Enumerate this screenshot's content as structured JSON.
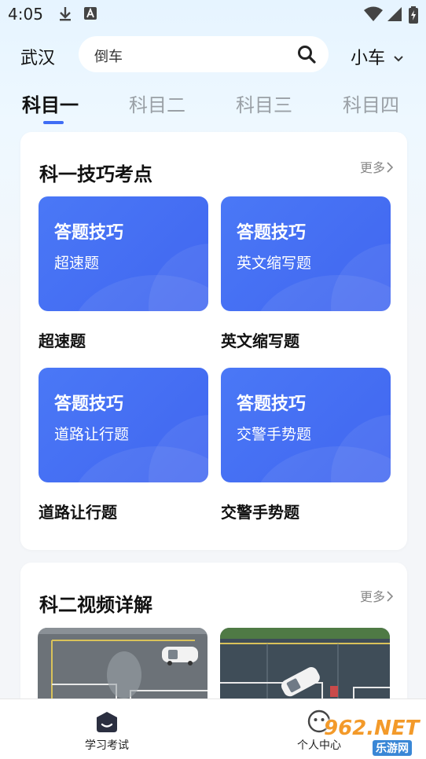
{
  "status_bar": {
    "time": "4:05"
  },
  "header": {
    "city": "武汉",
    "search": {
      "value": "倒车"
    },
    "vehicle": "小车"
  },
  "tabs": [
    {
      "label": "科目一"
    },
    {
      "label": "科目二"
    },
    {
      "label": "科目三"
    },
    {
      "label": "科目四"
    }
  ],
  "section1": {
    "title": "科一技巧考点",
    "more": "更多",
    "tiles": [
      {
        "head": "答题技巧",
        "sub": "超速题",
        "caption": "超速题"
      },
      {
        "head": "答题技巧",
        "sub": "英文缩写题",
        "caption": "英文缩写题"
      },
      {
        "head": "答题技巧",
        "sub": "道路让行题",
        "caption": "道路让行题"
      },
      {
        "head": "答题技巧",
        "sub": "交警手势题",
        "caption": "交警手势题"
      }
    ]
  },
  "section2": {
    "title": "科二视频详解",
    "more": "更多"
  },
  "bottom_nav": [
    {
      "label": "学习考试",
      "icon": "study-icon"
    },
    {
      "label": "个人中心",
      "icon": "profile-icon"
    }
  ],
  "watermark": {
    "text": "962.NET",
    "sub": "乐游网"
  },
  "colors": {
    "accent": "#3f6df5",
    "tile": "#4a78f6"
  }
}
